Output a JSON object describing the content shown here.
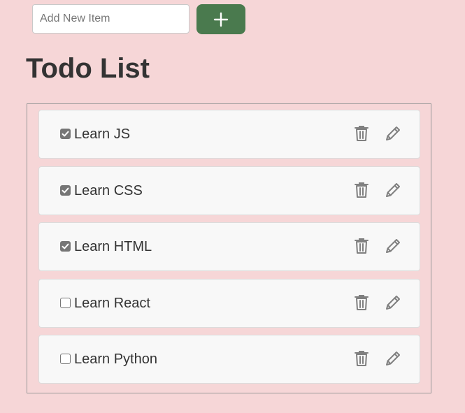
{
  "new_item": {
    "placeholder": "Add New Item",
    "value": "",
    "add_button_icon": "plus-icon"
  },
  "title": "Todo List",
  "colors": {
    "background": "#f6d6d7",
    "add_button": "#4a7a4e",
    "item_background": "#f8f8f8",
    "icon": "#808080",
    "checkbox": "#767676"
  },
  "todos": [
    {
      "label": "Learn JS",
      "checked": true
    },
    {
      "label": "Learn CSS",
      "checked": true
    },
    {
      "label": "Learn HTML",
      "checked": true
    },
    {
      "label": "Learn React",
      "checked": false
    },
    {
      "label": "Learn Python",
      "checked": false
    }
  ],
  "item_icons": {
    "delete": "trash-icon",
    "edit": "pencil-icon"
  }
}
